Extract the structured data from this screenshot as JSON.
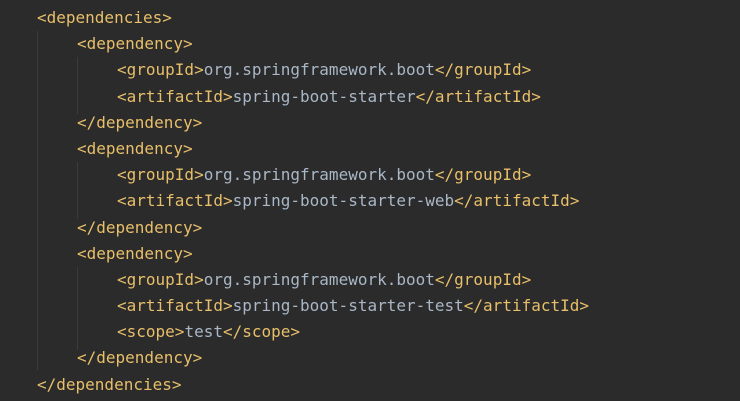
{
  "colors": {
    "background": "#2b2b2b",
    "tag": "#e8bf6a",
    "text": "#a9b7c6",
    "indent_guide": "#3b3b3b"
  },
  "lines": [
    {
      "level": 0,
      "open": "<dependencies>",
      "text": "",
      "close": ""
    },
    {
      "level": 1,
      "open": "<dependency>",
      "text": "",
      "close": ""
    },
    {
      "level": 2,
      "open": "<groupId>",
      "text": "org.springframework.boot",
      "close": "</groupId>"
    },
    {
      "level": 2,
      "open": "<artifactId>",
      "text": "spring-boot-starter",
      "close": "</artifactId>"
    },
    {
      "level": 1,
      "open": "</dependency>",
      "text": "",
      "close": ""
    },
    {
      "level": 1,
      "open": "<dependency>",
      "text": "",
      "close": ""
    },
    {
      "level": 2,
      "open": "<groupId>",
      "text": "org.springframework.boot",
      "close": "</groupId>"
    },
    {
      "level": 2,
      "open": "<artifactId>",
      "text": "spring-boot-starter-web",
      "close": "</artifactId>"
    },
    {
      "level": 1,
      "open": "</dependency>",
      "text": "",
      "close": ""
    },
    {
      "level": 1,
      "open": "<dependency>",
      "text": "",
      "close": ""
    },
    {
      "level": 2,
      "open": "<groupId>",
      "text": "org.springframework.boot",
      "close": "</groupId>"
    },
    {
      "level": 2,
      "open": "<artifactId>",
      "text": "spring-boot-starter-test",
      "close": "</artifactId>"
    },
    {
      "level": 2,
      "open": "<scope>",
      "text": "test",
      "close": "</scope>"
    },
    {
      "level": 1,
      "open": "</dependency>",
      "text": "",
      "close": ""
    },
    {
      "level": 0,
      "open": "</dependencies>",
      "text": "",
      "close": ""
    }
  ]
}
